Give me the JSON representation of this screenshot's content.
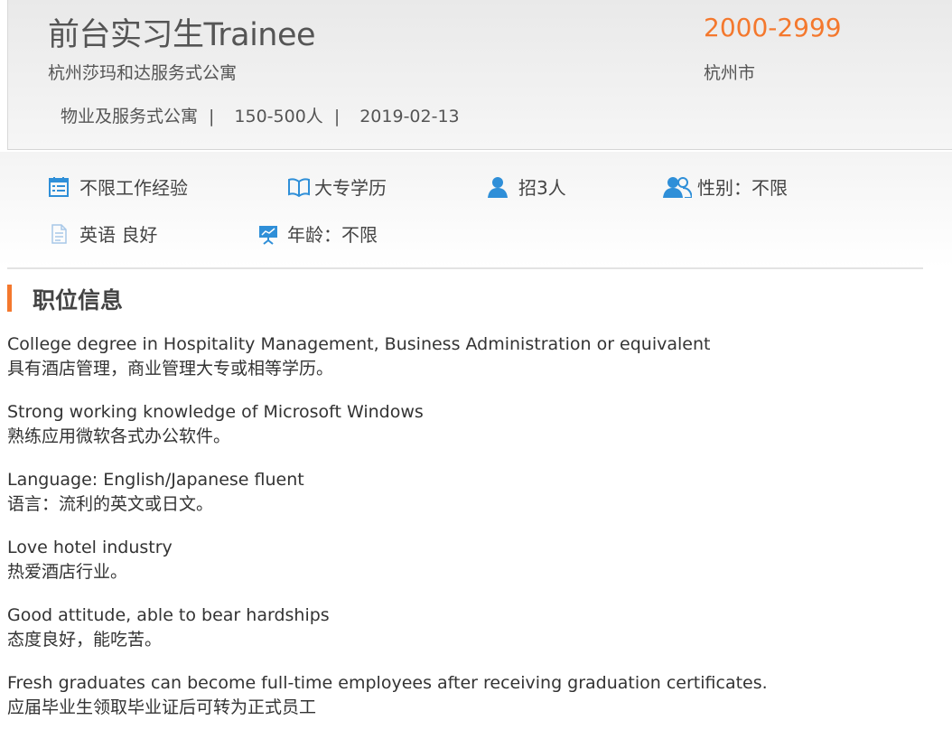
{
  "job": {
    "title": "前台实习生Trainee",
    "company": "杭州莎玛和达服务式公寓",
    "industry": "物业及服务式公寓",
    "company_size": "150-500人",
    "date": "2019-02-13",
    "separator": "|",
    "salary": "2000-2999",
    "city": "杭州市"
  },
  "requirements": {
    "experience": {
      "icon": "calendar-list-icon",
      "label": "不限工作经验"
    },
    "education": {
      "icon": "open-book-icon",
      "label": "大专学历"
    },
    "headcount": {
      "icon": "person-icon",
      "label": "招3人"
    },
    "gender": {
      "icon": "people-icon",
      "label": "性别：不限"
    },
    "language": {
      "icon": "document-icon",
      "label": "英语 良好"
    },
    "age": {
      "icon": "presentation-board-icon",
      "label": "年龄：不限"
    }
  },
  "section": {
    "title": "职位信息"
  },
  "description": [
    {
      "en": "College degree in Hospitality Management, Business Administration or equivalent",
      "zh": "具有酒店管理，商业管理大专或相等学历。"
    },
    {
      "en": "Strong working knowledge of Microsoft Windows",
      "zh": "熟练应用微软各式办公软件。"
    },
    {
      "en": "Language: English/Japanese fluent",
      "zh": "语言：流利的英文或日文。"
    },
    {
      "en": "Love hotel industry",
      "zh": "热爱酒店行业。"
    },
    {
      "en": "Good attitude, able to bear hardships",
      "zh": "态度良好，能吃苦。"
    },
    {
      "en": "Fresh graduates can become full-time employees after receiving graduation certificates.",
      "zh": "应届毕业生领取毕业证后可转为正式员工"
    }
  ],
  "colors": {
    "accent": "#f4782d",
    "icon": "#2f8fd8"
  }
}
